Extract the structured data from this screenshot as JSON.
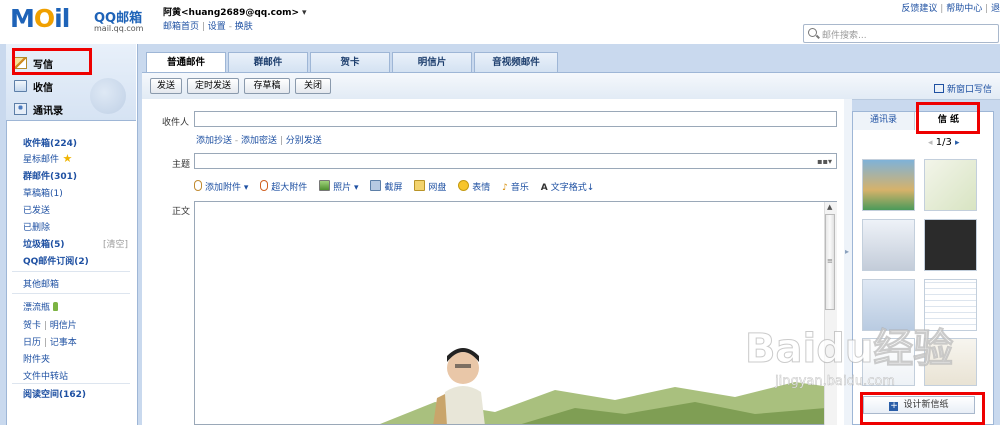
{
  "header": {
    "logo_text": "MOil",
    "logo_brand": "QQ邮箱",
    "logo_domain": "mail.qq.com",
    "user_display": "阿黄<huang2689@qq.com>",
    "user_links": [
      "邮箱首页",
      "设置",
      "换肤"
    ],
    "top_links": [
      "反馈建议",
      "帮助中心",
      "退"
    ],
    "search_placeholder": "邮件搜索..."
  },
  "sidebar": {
    "actions": [
      {
        "label": "写信",
        "icon": "pencil-icon"
      },
      {
        "label": "收信",
        "icon": "inbox-icon"
      },
      {
        "label": "通讯录",
        "icon": "contacts-icon"
      }
    ],
    "folders": [
      {
        "label": "收件箱(224)",
        "bold": true
      },
      {
        "label": "星标邮件",
        "icon": "star-icon"
      },
      {
        "label": "群邮件(301)",
        "bold": true
      },
      {
        "label": "草稿箱(1)"
      },
      {
        "label": "已发送"
      },
      {
        "label": "已删除"
      },
      {
        "label": "垃圾箱(5)",
        "bold": true,
        "extra": "[清空]"
      },
      {
        "label": "QQ邮件订阅(2)",
        "bold": true
      }
    ],
    "other_mailbox": "其他邮箱",
    "tools": [
      {
        "label": "漂流瓶",
        "icon": "bottle-icon"
      },
      {
        "label": "贺卡",
        "second": "明信片"
      },
      {
        "label": "日历",
        "second": "记事本"
      },
      {
        "label": "附件夹"
      },
      {
        "label": "文件中转站"
      }
    ],
    "reading": "阅读空间(162)"
  },
  "tabs": [
    "普通邮件",
    "群邮件",
    "贺卡",
    "明信片",
    "音视频邮件"
  ],
  "toolbar": {
    "buttons": [
      "发送",
      "定时发送",
      "存草稿",
      "关闭"
    ],
    "new_window": "新窗口写信"
  },
  "compose": {
    "to_label": "收件人",
    "to_value": "",
    "cc_links": [
      "添加抄送",
      "添加密送",
      "分别发送"
    ],
    "subject_label": "主题",
    "subject_value": "",
    "attachments": [
      "添加附件",
      "超大附件",
      "照片",
      "截屏",
      "网盘",
      "表情",
      "音乐",
      "文字格式"
    ],
    "body_label": "正文"
  },
  "rightpanel": {
    "tabs": [
      "通讯录",
      "信 纸"
    ],
    "active_tab": "信 纸",
    "pager": "1/3",
    "design_button": "设计新信纸"
  },
  "watermark": {
    "main": "Baidu经验",
    "sub": "jingyan.baidu.com"
  },
  "colors": {
    "highlight": "#e00000",
    "link": "#1e50a2",
    "frame": "#c9d9ee"
  }
}
